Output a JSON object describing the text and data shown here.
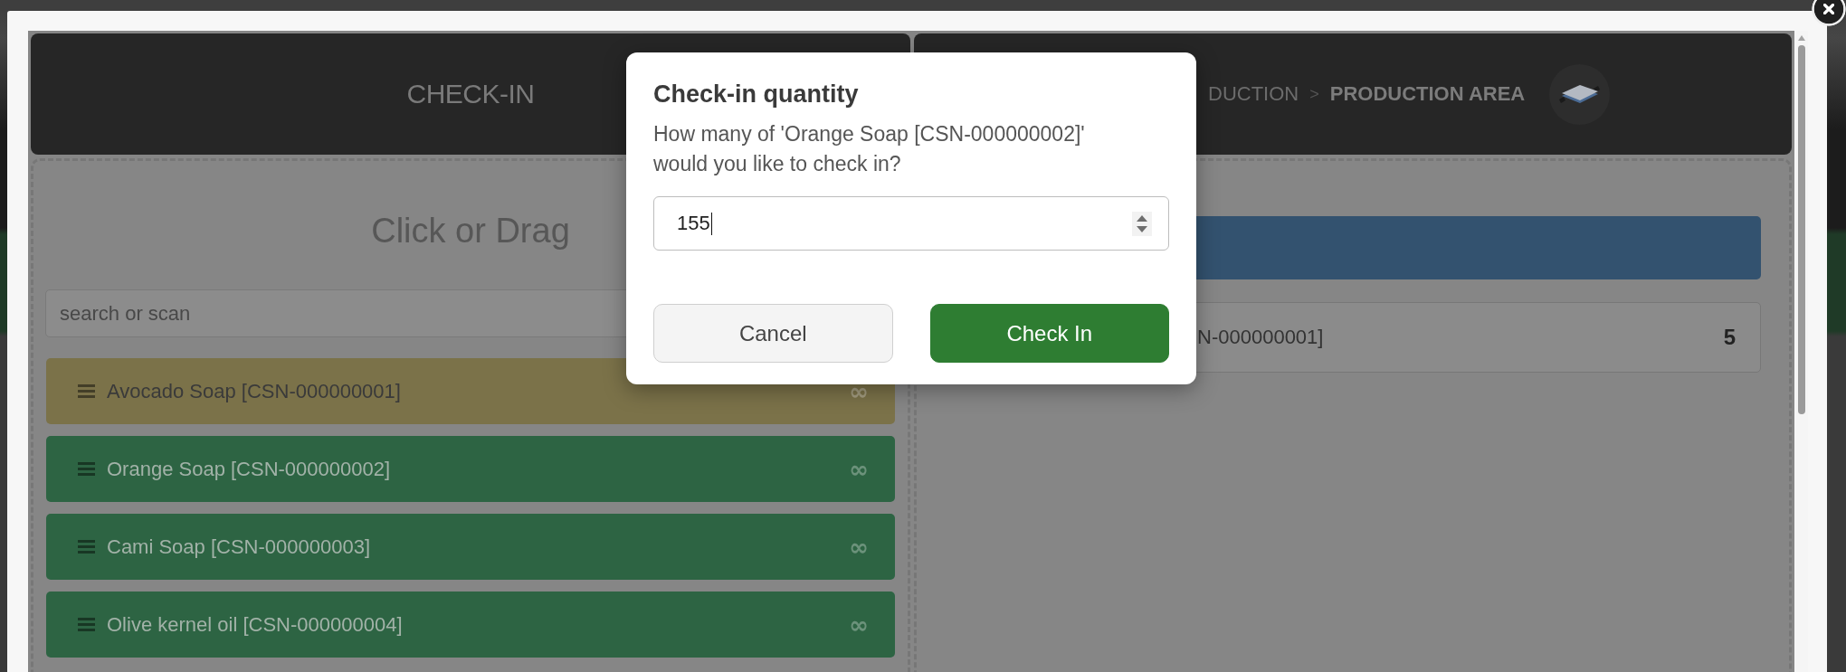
{
  "lightbox": {
    "left_panel": {
      "title": "CHECK-IN",
      "drop_hint": "Click or Drag",
      "search": {
        "placeholder": "search or scan"
      },
      "items": [
        {
          "label": "Avocado Soap [CSN-000000001]",
          "stock": "∞",
          "color": "#7b7249"
        },
        {
          "label": "Orange Soap [CSN-000000002]",
          "stock": "∞",
          "color": "#2d6443"
        },
        {
          "label": "Cami Soap [CSN-000000003]",
          "stock": "∞",
          "color": "#2d6443"
        },
        {
          "label": "Olive kernel oil [CSN-000000004]",
          "stock": "∞",
          "color": "#2d6443"
        }
      ]
    },
    "right_panel": {
      "breadcrumb": [
        {
          "label": "DUCTION",
          "current": false
        },
        {
          "label": "PRODUCTION AREA",
          "current": true
        }
      ],
      "separator": ">",
      "items": [
        {
          "label": "N-000000001]",
          "quantity": "5"
        }
      ]
    }
  },
  "dialog": {
    "title": "Check-in quantity",
    "message": "How many of 'Orange Soap [CSN-000000002]' would you like to check in?",
    "quantity": {
      "value": "155"
    },
    "buttons": [
      {
        "label": "Cancel",
        "kind": "secondary"
      },
      {
        "label": "Check In",
        "kind": "primary"
      }
    ]
  }
}
